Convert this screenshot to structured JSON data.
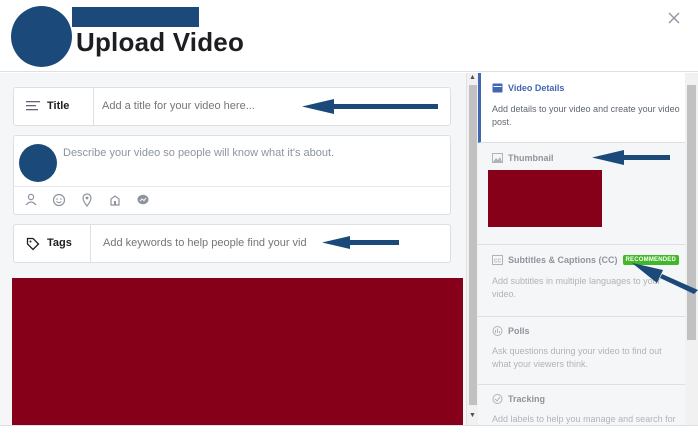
{
  "header": {
    "title": "Upload Video",
    "close_symbol": "✕"
  },
  "form": {
    "title_field": {
      "label": "Title",
      "placeholder": "Add a title for your video here..."
    },
    "description": {
      "placeholder": "Describe your video so people will know what it's about.",
      "toolbar_icons": [
        "tag-people-icon",
        "emoji-icon",
        "location-icon",
        "check-in-icon",
        "messenger-icon"
      ]
    },
    "tags_field": {
      "label": "Tags",
      "placeholder": "Add keywords to help people find your vid"
    }
  },
  "sidebar": {
    "items": [
      {
        "label": "Video Details",
        "description": "Add details to your video and create your video post.",
        "icon": "video-details-icon",
        "active": true
      },
      {
        "label": "Thumbnail",
        "description": "",
        "icon": "image-icon",
        "active": false
      },
      {
        "label": "Subtitles & Captions (CC)",
        "badge": "RECOMMENDED",
        "description": "Add subtitles in multiple languages to your video.",
        "icon": "cc-icon",
        "active": false
      },
      {
        "label": "Polls",
        "description": "Ask questions during your video to find out what your viewers think.",
        "icon": "poll-icon",
        "active": false
      },
      {
        "label": "Tracking",
        "description": "Add labels to help you manage and search for",
        "icon": "tracking-icon",
        "active": false
      }
    ]
  },
  "colors": {
    "accent": "#4267b2",
    "badge": "#42b72a",
    "redaction_blue": "#1b4a7a",
    "redaction_red": "#86001a",
    "annotation_arrow": "#1b4a7a"
  }
}
